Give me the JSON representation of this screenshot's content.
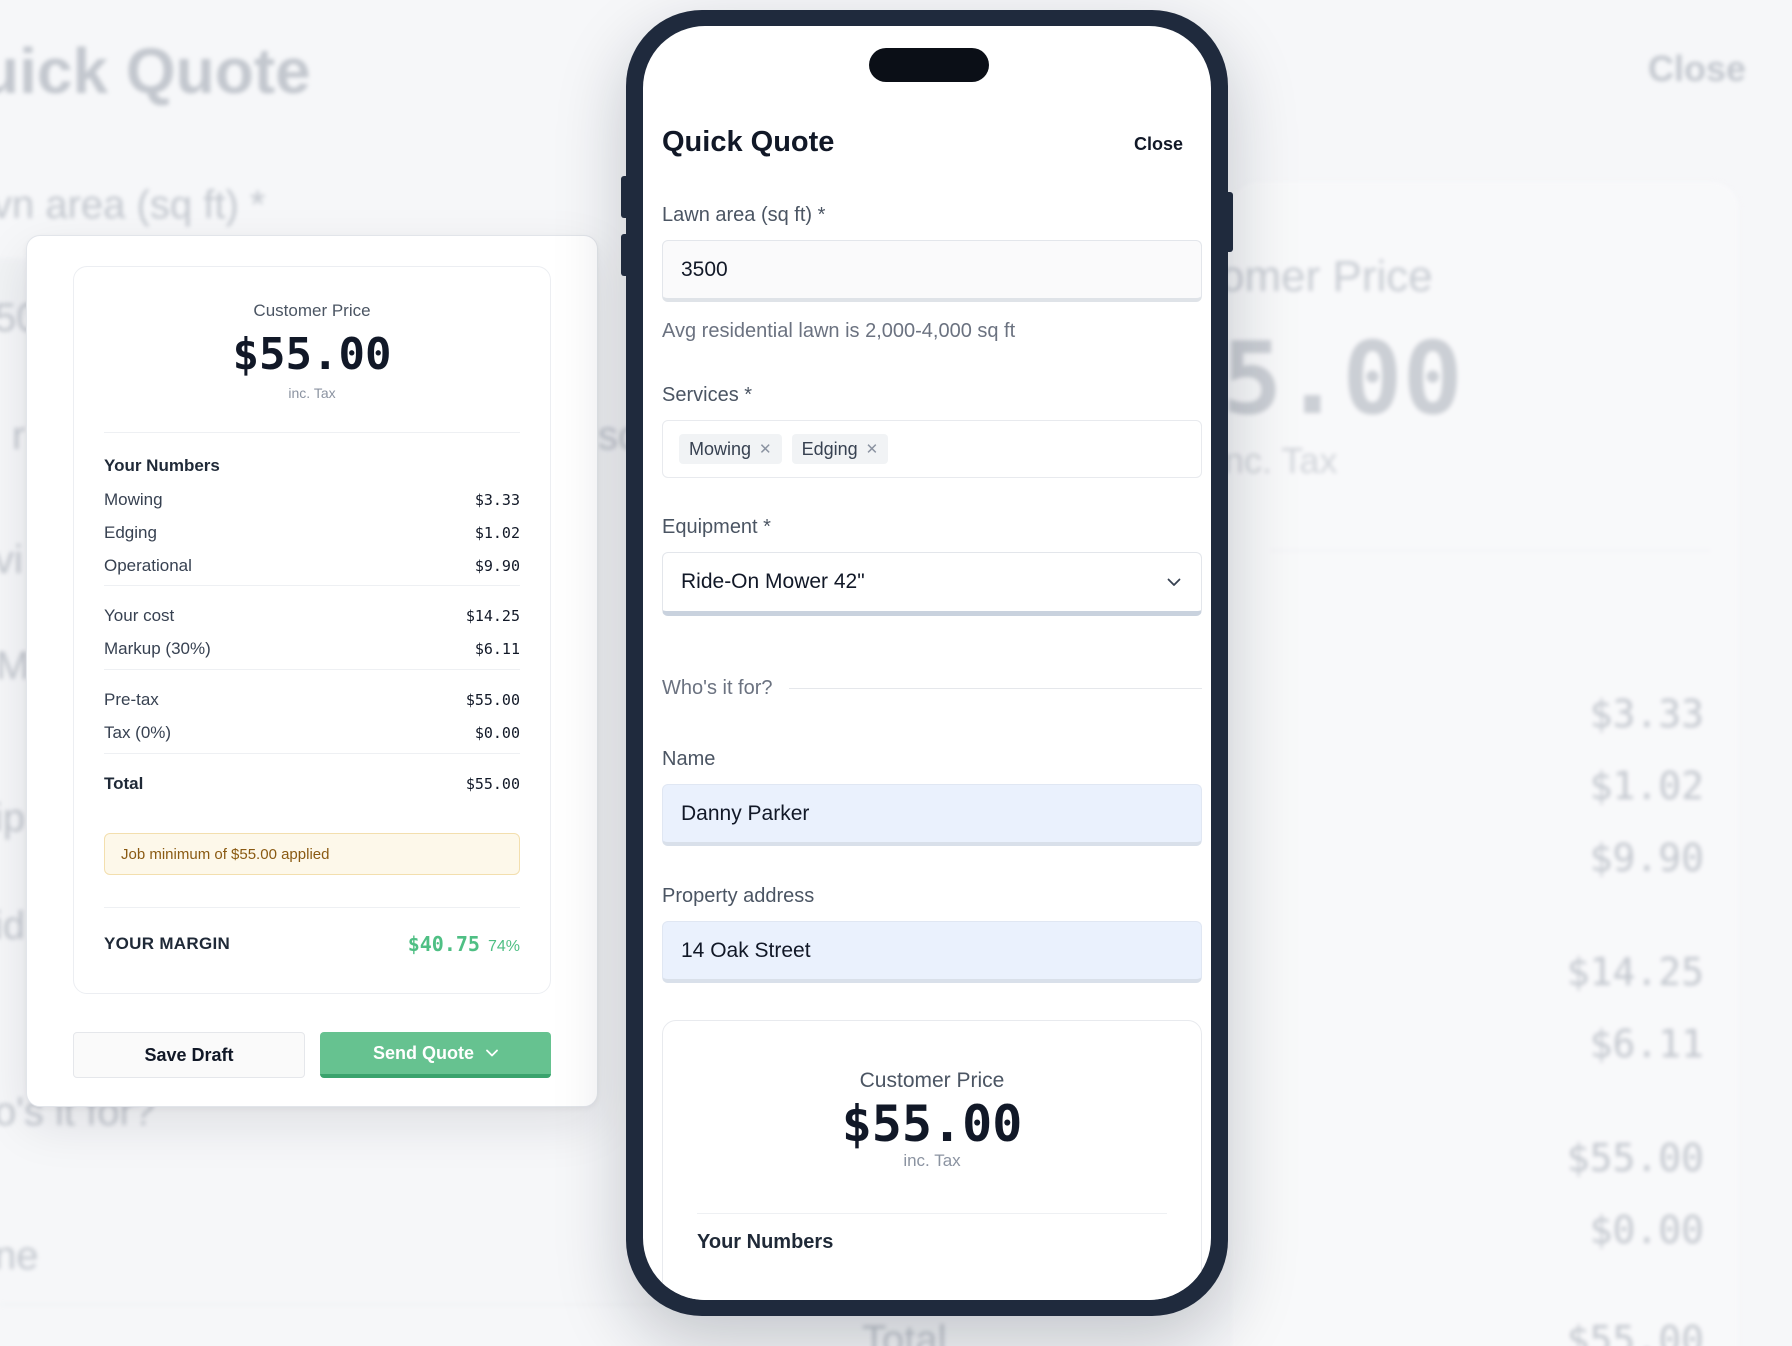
{
  "background": {
    "title": "uick Quote",
    "close": "Close",
    "lawn_label": "vn area (sq ft) *",
    "frag_50": "50",
    "frag_r": "r",
    "frag_vi": "vi",
    "frag_m": "M",
    "frag_ip": "ip",
    "frag_id": "id",
    "frag_who": "o's it for?",
    "frag_ne": "ne",
    "frag_sc": "sc",
    "customer_price": "omer Price",
    "big_price": "5.00",
    "inc_tax": "nc. Tax",
    "values": [
      "$3.33",
      "$1.02",
      "$9.90",
      "$14.25",
      "$6.11",
      "$55.00",
      "$0.00"
    ],
    "total_label": "Total",
    "total_value": "$55.00"
  },
  "breakdown": {
    "customer_price_label": "Customer Price",
    "customer_price": "$55.00",
    "inc_tax": "inc. Tax",
    "your_numbers": "Your Numbers",
    "items": [
      {
        "label": "Mowing",
        "value": "$3.33"
      },
      {
        "label": "Edging",
        "value": "$1.02"
      },
      {
        "label": "Operational",
        "value": "$9.90"
      }
    ],
    "cost": [
      {
        "label": "Your cost",
        "value": "$14.25"
      },
      {
        "label": "Markup (30%)",
        "value": "$6.11"
      }
    ],
    "tax": [
      {
        "label": "Pre-tax",
        "value": "$55.00"
      },
      {
        "label": "Tax (0%)",
        "value": "$0.00"
      }
    ],
    "total": {
      "label": "Total",
      "value": "$55.00"
    },
    "notice": "Job minimum of $55.00 applied",
    "margin_label": "YOUR MARGIN",
    "margin_value": "$40.75",
    "margin_pct": "74%",
    "save_draft": "Save Draft",
    "send_quote": "Send Quote"
  },
  "phone": {
    "title": "Quick Quote",
    "close": "Close",
    "lawn_label": "Lawn area (sq ft) *",
    "lawn_value": "3500",
    "lawn_help": "Avg residential lawn is 2,000-4,000 sq ft",
    "services_label": "Services *",
    "services": [
      "Mowing",
      "Edging"
    ],
    "equipment_label": "Equipment *",
    "equipment_value": "Ride-On Mower 42\"",
    "who_label": "Who's it for?",
    "name_label": "Name",
    "name_value": "Danny Parker",
    "address_label": "Property address",
    "address_value": "14 Oak Street",
    "customer_price_label": "Customer Price",
    "customer_price": "$55.00",
    "inc_tax": "inc. Tax",
    "your_numbers": "Your Numbers"
  },
  "colors": {
    "accent_green": "#66c290",
    "margin_green": "#4fbf84",
    "phone_frame": "#1f2a3d",
    "filled_input": "#eaf1fd"
  },
  "icons": {
    "chip_remove": "close-icon",
    "select": "chevron-down-icon",
    "send_dropdown": "chevron-down-icon"
  }
}
